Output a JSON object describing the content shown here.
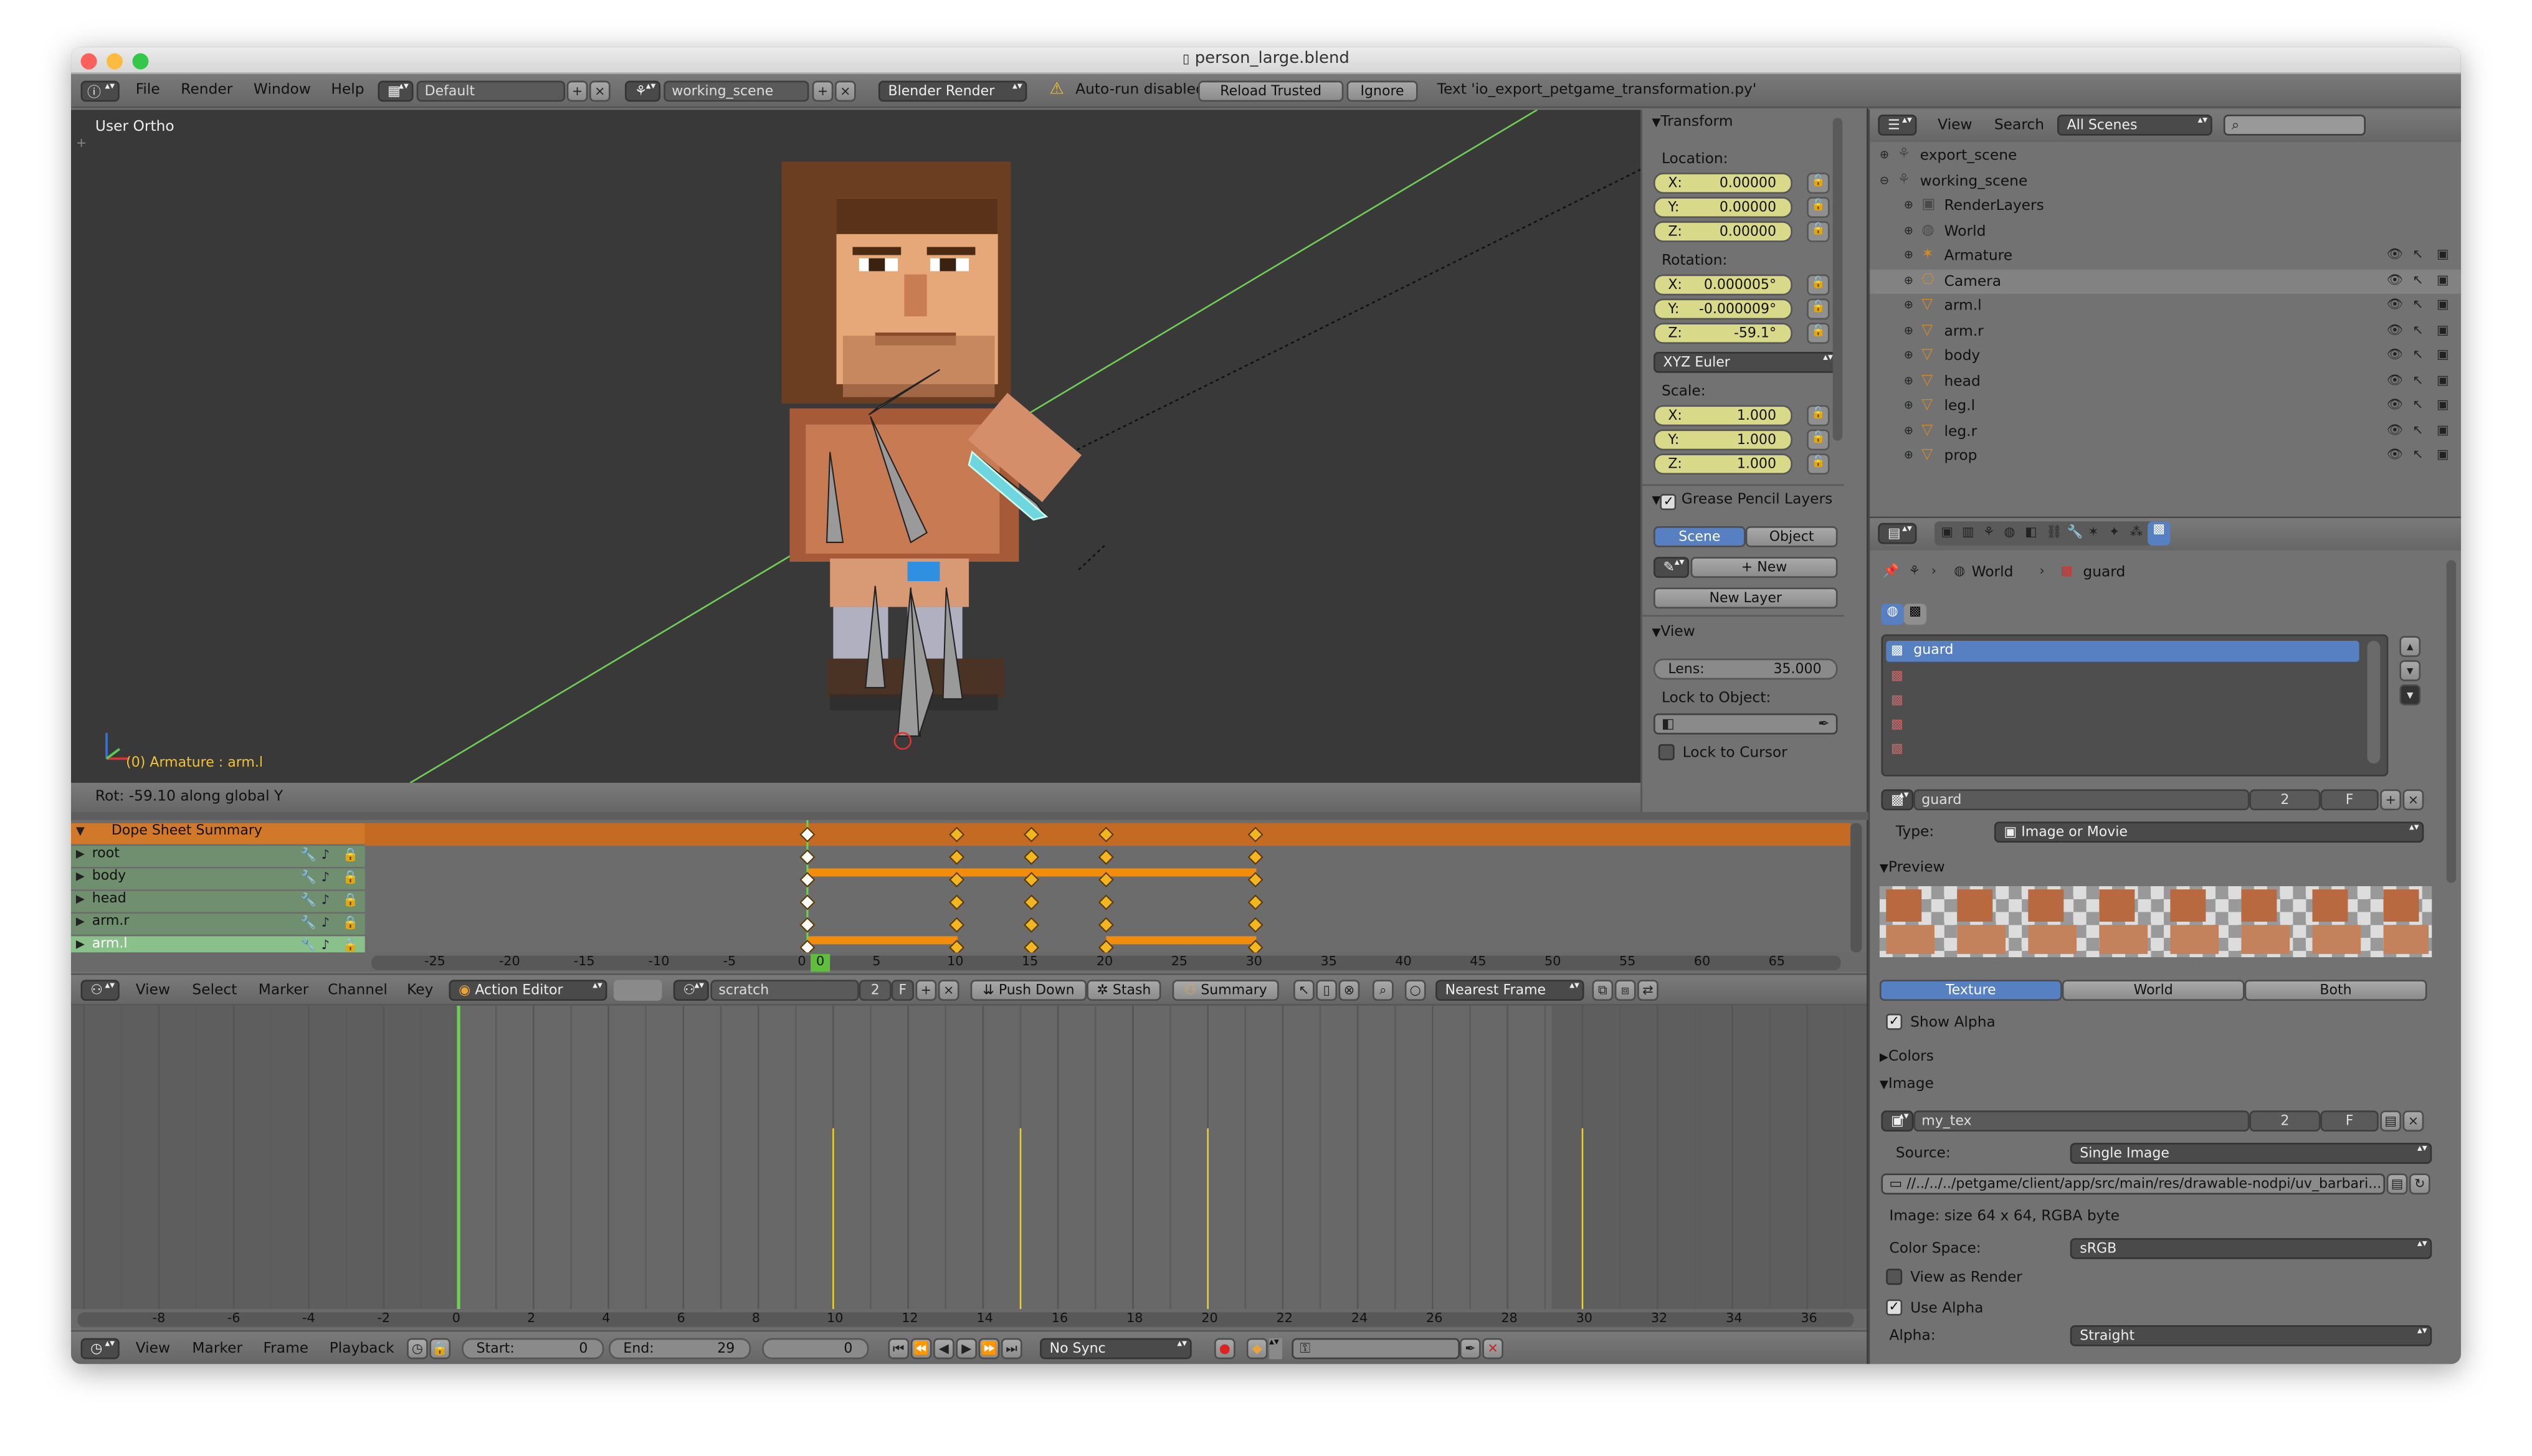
{
  "window": {
    "title": "person_large.blend",
    "file_icon": "blend-file-icon"
  },
  "info_header": {
    "menus": [
      "File",
      "Render",
      "Window",
      "Help"
    ],
    "screen_layout": "Default",
    "scene": "working_scene",
    "render_engine": "Blender Render",
    "warning": "Auto-run disabled",
    "reload_trusted": "Reload Trusted",
    "ignore": "Ignore",
    "text_message": "Text 'io_export_petgame_transformation.py'"
  },
  "viewport": {
    "view_name": "User Ortho",
    "active_object": "(0) Armature : arm.l",
    "status": "Rot: -59.10 along global Y"
  },
  "properties_panel": {
    "transform_title": "Transform",
    "location_label": "Location:",
    "location": [
      {
        "axis": "X:",
        "value": "0.00000"
      },
      {
        "axis": "Y:",
        "value": "0.00000"
      },
      {
        "axis": "Z:",
        "value": "0.00000"
      }
    ],
    "rotation_label": "Rotation:",
    "rotation": [
      {
        "axis": "X:",
        "value": "0.000005°"
      },
      {
        "axis": "Y:",
        "value": "-0.000009°"
      },
      {
        "axis": "Z:",
        "value": "-59.1°"
      }
    ],
    "rotation_mode": "XYZ Euler",
    "scale_label": "Scale:",
    "scale": [
      {
        "axis": "X:",
        "value": "1.000"
      },
      {
        "axis": "Y:",
        "value": "1.000"
      },
      {
        "axis": "Z:",
        "value": "1.000"
      }
    ],
    "grease_pencil_title": "Grease Pencil Layers",
    "gp_scene": "Scene",
    "gp_object": "Object",
    "gp_new": "New",
    "gp_new_layer": "New Layer",
    "view_title": "View",
    "lens_label": "Lens:",
    "lens_value": "35.000",
    "lock_to_object": "Lock to Object:",
    "lock_to_cursor": "Lock to Cursor"
  },
  "outliner": {
    "menus": [
      "View",
      "Search"
    ],
    "filter": "All Scenes",
    "items": [
      {
        "label": "export_scene",
        "indent": 0,
        "icon": "scene-icon"
      },
      {
        "label": "working_scene",
        "indent": 0,
        "icon": "scene-icon"
      },
      {
        "label": "RenderLayers",
        "indent": 1,
        "icon": "render-layers-icon"
      },
      {
        "label": "World",
        "indent": 1,
        "icon": "world-icon"
      },
      {
        "label": "Armature",
        "indent": 1,
        "icon": "armature-icon"
      },
      {
        "label": "Camera",
        "indent": 1,
        "icon": "camera-icon"
      },
      {
        "label": "arm.l",
        "indent": 1,
        "icon": "mesh-icon"
      },
      {
        "label": "arm.r",
        "indent": 1,
        "icon": "mesh-icon"
      },
      {
        "label": "body",
        "indent": 1,
        "icon": "mesh-icon"
      },
      {
        "label": "head",
        "indent": 1,
        "icon": "mesh-icon"
      },
      {
        "label": "leg.l",
        "indent": 1,
        "icon": "mesh-icon"
      },
      {
        "label": "leg.r",
        "indent": 1,
        "icon": "mesh-icon"
      },
      {
        "label": "prop",
        "indent": 1,
        "icon": "mesh-icon"
      }
    ]
  },
  "texture_props": {
    "breadcrumb": [
      "World",
      "guard"
    ],
    "slots": [
      "guard",
      "",
      "",
      "",
      ""
    ],
    "texture_name": "guard",
    "users": "2",
    "fake": "F",
    "type_label": "Type:",
    "type_value": "Image or Movie",
    "preview_title": "Preview",
    "tabs": [
      "Texture",
      "World",
      "Both"
    ],
    "show_alpha": "Show Alpha",
    "colors_title": "Colors",
    "image_title": "Image",
    "image_name": "my_tex",
    "image_users": "2",
    "image_fake": "F",
    "source_label": "Source:",
    "source_value": "Single Image",
    "filepath": "//../../../petgame/client/app/src/main/res/drawable-nodpi/uv_barbari...",
    "image_info": "Image: size 64 x 64, RGBA byte",
    "color_space_label": "Color Space:",
    "color_space_value": "sRGB",
    "view_as_render": "View as Render",
    "use_alpha": "Use Alpha",
    "alpha_label": "Alpha:",
    "alpha_value": "Straight"
  },
  "dopesheet": {
    "channels": [
      {
        "label": "Dope Sheet Summary",
        "type": "summary"
      },
      {
        "label": "root",
        "type": "channel"
      },
      {
        "label": "body",
        "type": "channel"
      },
      {
        "label": "head",
        "type": "channel"
      },
      {
        "label": "arm.r",
        "type": "channel"
      },
      {
        "label": "arm.l",
        "type": "channel-selected"
      }
    ],
    "keyframes": [
      0,
      10,
      15,
      20,
      30
    ],
    "ruler": [
      "-25",
      "-20",
      "-15",
      "-10",
      "-5",
      "0",
      "5",
      "10",
      "15",
      "20",
      "25",
      "30",
      "35",
      "40",
      "45",
      "50",
      "55",
      "60",
      "65"
    ],
    "current_frame": "0",
    "menus": [
      "View",
      "Select",
      "Marker",
      "Channel",
      "Key"
    ],
    "mode": "Action Editor",
    "action": "scratch",
    "action_users": "2",
    "action_fake": "F",
    "push_down": "Push Down",
    "stash": "Stash",
    "summary": "Summary",
    "snap": "Nearest Frame"
  },
  "timeline": {
    "ruler": [
      "-8",
      "-6",
      "-4",
      "-2",
      "0",
      "2",
      "4",
      "6",
      "8",
      "10",
      "12",
      "14",
      "16",
      "18",
      "20",
      "22",
      "24",
      "26",
      "28",
      "30",
      "32",
      "34",
      "36"
    ],
    "keyframe_lines": [
      10,
      15,
      20,
      30
    ],
    "menus": [
      "View",
      "Marker",
      "Frame",
      "Playback"
    ],
    "start_label": "Start:",
    "start_value": "0",
    "end_label": "End:",
    "end_value": "29",
    "current": "0",
    "sync": "No Sync"
  }
}
